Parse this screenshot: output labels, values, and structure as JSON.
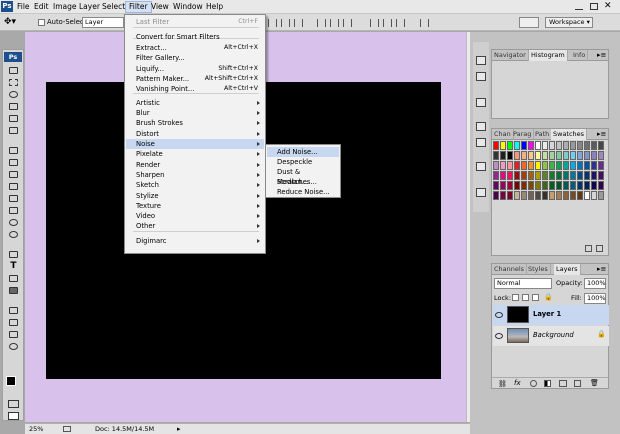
{
  "menubar": {
    "items": [
      "File",
      "Edit",
      "Image",
      "Layer",
      "Select",
      "Filter",
      "View",
      "Window",
      "Help"
    ],
    "active": "Filter",
    "workspace_label": "Workspace"
  },
  "options": {
    "auto_select_label": "Auto-Select:",
    "auto_select_value": "Layer"
  },
  "filter_menu": {
    "items": [
      {
        "label": "Last Filter",
        "shortcut": "Ctrl+F"
      },
      {
        "label": "Convert for Smart Filters"
      },
      {
        "label": "Extract...",
        "shortcut": "Alt+Ctrl+X"
      },
      {
        "label": "Filter Gallery..."
      },
      {
        "label": "Liquify...",
        "shortcut": "Shift+Ctrl+X"
      },
      {
        "label": "Pattern Maker...",
        "shortcut": "Alt+Shift+Ctrl+X"
      },
      {
        "label": "Vanishing Point...",
        "shortcut": "Alt+Ctrl+V"
      },
      {
        "label": "Artistic"
      },
      {
        "label": "Blur"
      },
      {
        "label": "Brush Strokes"
      },
      {
        "label": "Distort"
      },
      {
        "label": "Noise"
      },
      {
        "label": "Pixelate"
      },
      {
        "label": "Render"
      },
      {
        "label": "Sharpen"
      },
      {
        "label": "Sketch"
      },
      {
        "label": "Stylize"
      },
      {
        "label": "Texture"
      },
      {
        "label": "Video"
      },
      {
        "label": "Other"
      },
      {
        "label": "Digimarc"
      }
    ]
  },
  "noise_menu": {
    "items": [
      "Add Noise...",
      "Despeckle",
      "Dust & Scratches...",
      "Median...",
      "Reduce Noise..."
    ]
  },
  "panels": {
    "top_tabs": [
      "Navigator",
      "Histogram",
      "Info"
    ],
    "mid_tabs": [
      "Chan",
      "Parag",
      "Path",
      "Swatches"
    ],
    "layers_tabs": [
      "Channels",
      "Styles",
      "Layers"
    ],
    "blend_mode": "Normal",
    "opacity_label": "Opacity:",
    "opacity_value": "100%",
    "lock_label": "Lock:",
    "fill_label": "Fill:",
    "fill_value": "100%",
    "layers": [
      "Layer 1",
      "Background"
    ]
  },
  "status": {
    "zoom": "25%",
    "doc": "Doc: 14.5M/14.5M"
  },
  "colors": {
    "canvas_background": "#d8c2ec",
    "document": "#000000",
    "highlight": "#c6d7ef"
  }
}
